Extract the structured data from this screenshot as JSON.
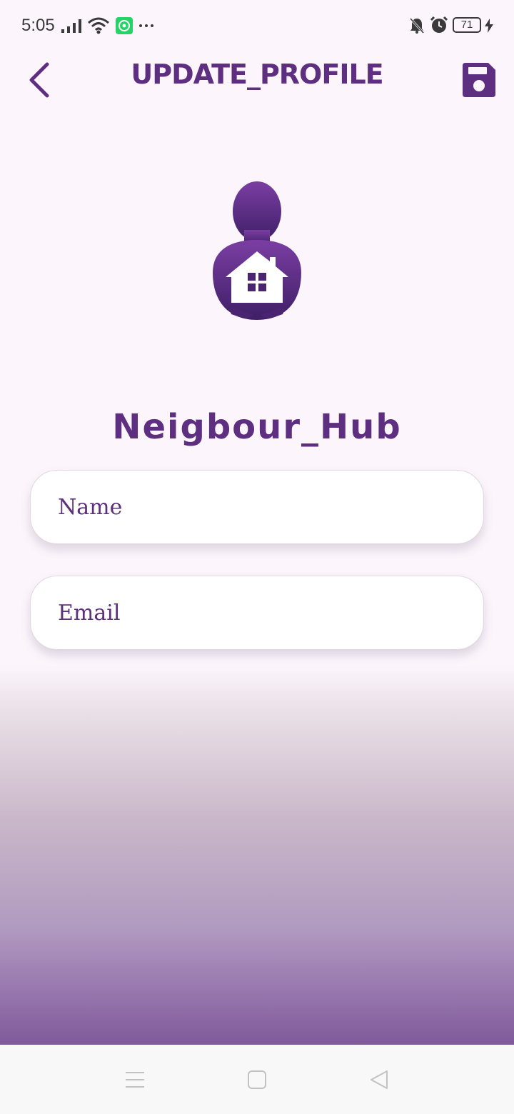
{
  "status_bar": {
    "time": "5:05",
    "battery_level": "71",
    "icons": [
      "signal-icon",
      "wifi-icon",
      "whatsapp-icon",
      "more-dots-icon",
      "mute-bell-icon",
      "alarm-icon",
      "battery-icon",
      "charging-icon"
    ]
  },
  "app_bar": {
    "title": "UPDATE_PROFILE",
    "back_icon": "chevron-left-icon",
    "save_icon": "floppy-disk-icon"
  },
  "brand": {
    "name": "Neigbour_Hub",
    "logo_icon": "person-hugging-house-icon"
  },
  "form": {
    "name_placeholder": "Name",
    "name_value": "",
    "email_placeholder": "Email",
    "email_value": ""
  },
  "nav_bar": {
    "icons": [
      "menu-icon",
      "home-square-icon",
      "back-triangle-icon"
    ]
  },
  "colors": {
    "accent": "#5e2f80",
    "background": "#fcf6fc",
    "gradient_bottom": "#7f5a99"
  }
}
